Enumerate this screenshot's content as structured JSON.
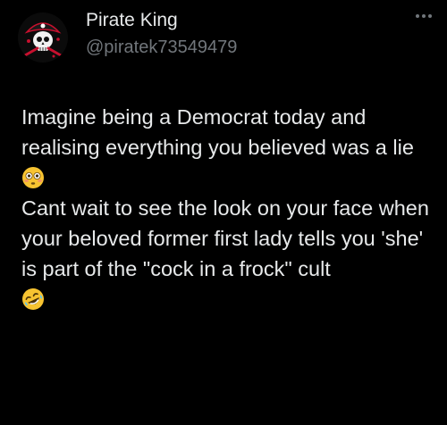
{
  "tweet": {
    "author": {
      "display_name": "Pirate King",
      "handle": "@piratek73549479",
      "avatar_icon": "pirate-skull-avatar"
    },
    "more_icon": "more-horizontal-icon",
    "paragraphs": [
      "Imagine being a Democrat today and realising everything you believed was a lie",
      "Cant wait to see the look on your face when your beloved former  first lady tells you 'she' is part of the \"cock in a frock\" cult"
    ],
    "emojis": [
      "flushed-face-emoji",
      "rolling-on-floor-laughing-emoji"
    ],
    "colors": {
      "background": "#000000",
      "text": "#e7e9ea",
      "secondary_text": "#71767b",
      "emoji_yellow": "#f7c331"
    }
  }
}
